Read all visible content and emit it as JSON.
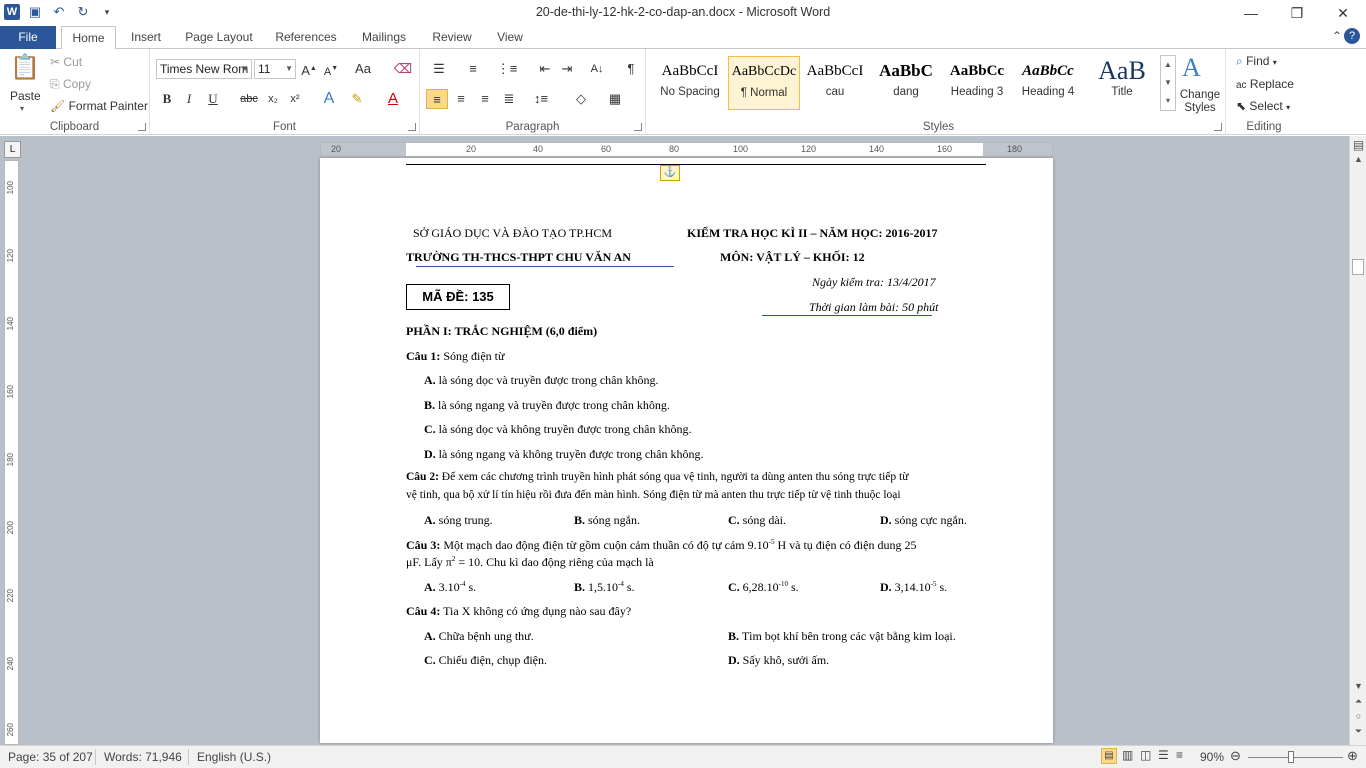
{
  "window": {
    "title": "20-de-thi-ly-12-hk-2-co-dap-an.docx - Microsoft Word",
    "minimize": "—",
    "restore": "❐",
    "close": "✕"
  },
  "tabs": [
    "File",
    "Home",
    "Insert",
    "Page Layout",
    "References",
    "Mailings",
    "Review",
    "View"
  ],
  "ribbon": {
    "clipboard": {
      "paste": "Paste",
      "cut": "Cut",
      "copy": "Copy",
      "format_painter": "Format Painter",
      "label": "Clipboard"
    },
    "font": {
      "family": "Times New Rom",
      "size": "11",
      "label": "Font"
    },
    "paragraph": {
      "label": "Paragraph"
    },
    "styles": {
      "label": "Styles",
      "items": [
        {
          "preview": "AaBbCcI",
          "name": "No Spacing"
        },
        {
          "preview": "AaBbCcDc",
          "name": "¶ Normal"
        },
        {
          "preview": "AaBbCcI",
          "name": "cau"
        },
        {
          "preview": "AaBbC",
          "name": "dang"
        },
        {
          "preview": "AaBbCc",
          "name": "Heading 3"
        },
        {
          "preview": "AaBbCc",
          "name": "Heading 4"
        },
        {
          "preview": "AaB",
          "name": "Title"
        }
      ],
      "change": "Change Styles"
    },
    "editing": {
      "find": "Find",
      "replace": "Replace",
      "select": "Select",
      "label": "Editing"
    }
  },
  "ruler": {
    "h_ticks": [
      "20",
      "20",
      "40",
      "60",
      "80",
      "100",
      "120",
      "140",
      "160",
      "180"
    ],
    "v_ticks": [
      "100",
      "120",
      "140",
      "160",
      "180",
      "200",
      "220",
      "240",
      "260"
    ]
  },
  "doc": {
    "dept": "SỞ GIÁO DỤC VÀ ĐÀO TẠO TP.HCM",
    "exam": "KIỂM TRA HỌC KÌ II – NĂM HỌC: 2016-2017",
    "school": "TRƯỜNG TH-THCS-THPT  CHU VĂN AN",
    "subject": "MÔN: VẬT LÝ – KHỐI: 12",
    "date": "Ngày kiểm tra: 13/4/2017",
    "time": "Thời gian làm bài: 50 phút",
    "code": "MÃ ĐỀ: 135",
    "part1": "PHẦN I: TRẮC NGHIỆM (6,0 điểm)",
    "q1": {
      "label": "Câu 1:",
      "text": " Sóng điện từ",
      "a": "là sóng dọc và truyền được trong chân không.",
      "b": "là sóng ngang và truyền được trong chân không.",
      "c": "là sóng dọc và không truyền được trong chân không.",
      "d": "là sóng ngang và không truyền được trong chân không."
    },
    "q2": {
      "label": "Câu 2:",
      "line1": " Để xem các chương trình truyền hình phát sóng qua vệ tinh, người ta dùng anten thu sóng trực tiếp từ",
      "line2": "vệ tinh, qua bộ xử lí tín hiệu rồi đưa đến màn hình. Sóng điện từ mà anten thu trực tiếp từ vệ tinh thuộc loại",
      "a": "sóng trung.",
      "b": "sóng ngắn.",
      "c": "sóng dài.",
      "d": "sóng cực ngắn."
    },
    "q3": {
      "label": "Câu 3:",
      "line1a": " Một mạch dao động điện từ gồm cuộn cảm thuần có độ tự cảm 9.10",
      "line1exp": "-5",
      "line1b": " H và tụ điện có điện dung 25",
      "line2a": "μF. Lấy π",
      "line2exp": "2",
      "line2b": " = 10. Chu kì dao động riêng của mạch là",
      "a": "3.10",
      "a_exp": "-4",
      "b": "1,5.10",
      "b_exp": "-4",
      "c": "6,28.10",
      "c_exp": "-10",
      "d": "3,14.10",
      "d_exp": "-5",
      "unit": " s."
    },
    "q4": {
      "label": "Câu 4:",
      "text": " Tia X không có ứng dụng nào sau đây?",
      "a": "Chữa bệnh ung thư.",
      "b": "Tìm bọt khí bên trong các vật bằng kim loại.",
      "c": "Chiếu điện, chụp điện.",
      "d": "Sấy khô, sưởi ấm."
    },
    "opt": {
      "A": "A.",
      "B": "B.",
      "C": "C.",
      "D": "D."
    }
  },
  "status": {
    "page": "Page: 35 of 207",
    "words": "Words: 71,946",
    "lang": "English (U.S.)",
    "zoom": "90%"
  }
}
